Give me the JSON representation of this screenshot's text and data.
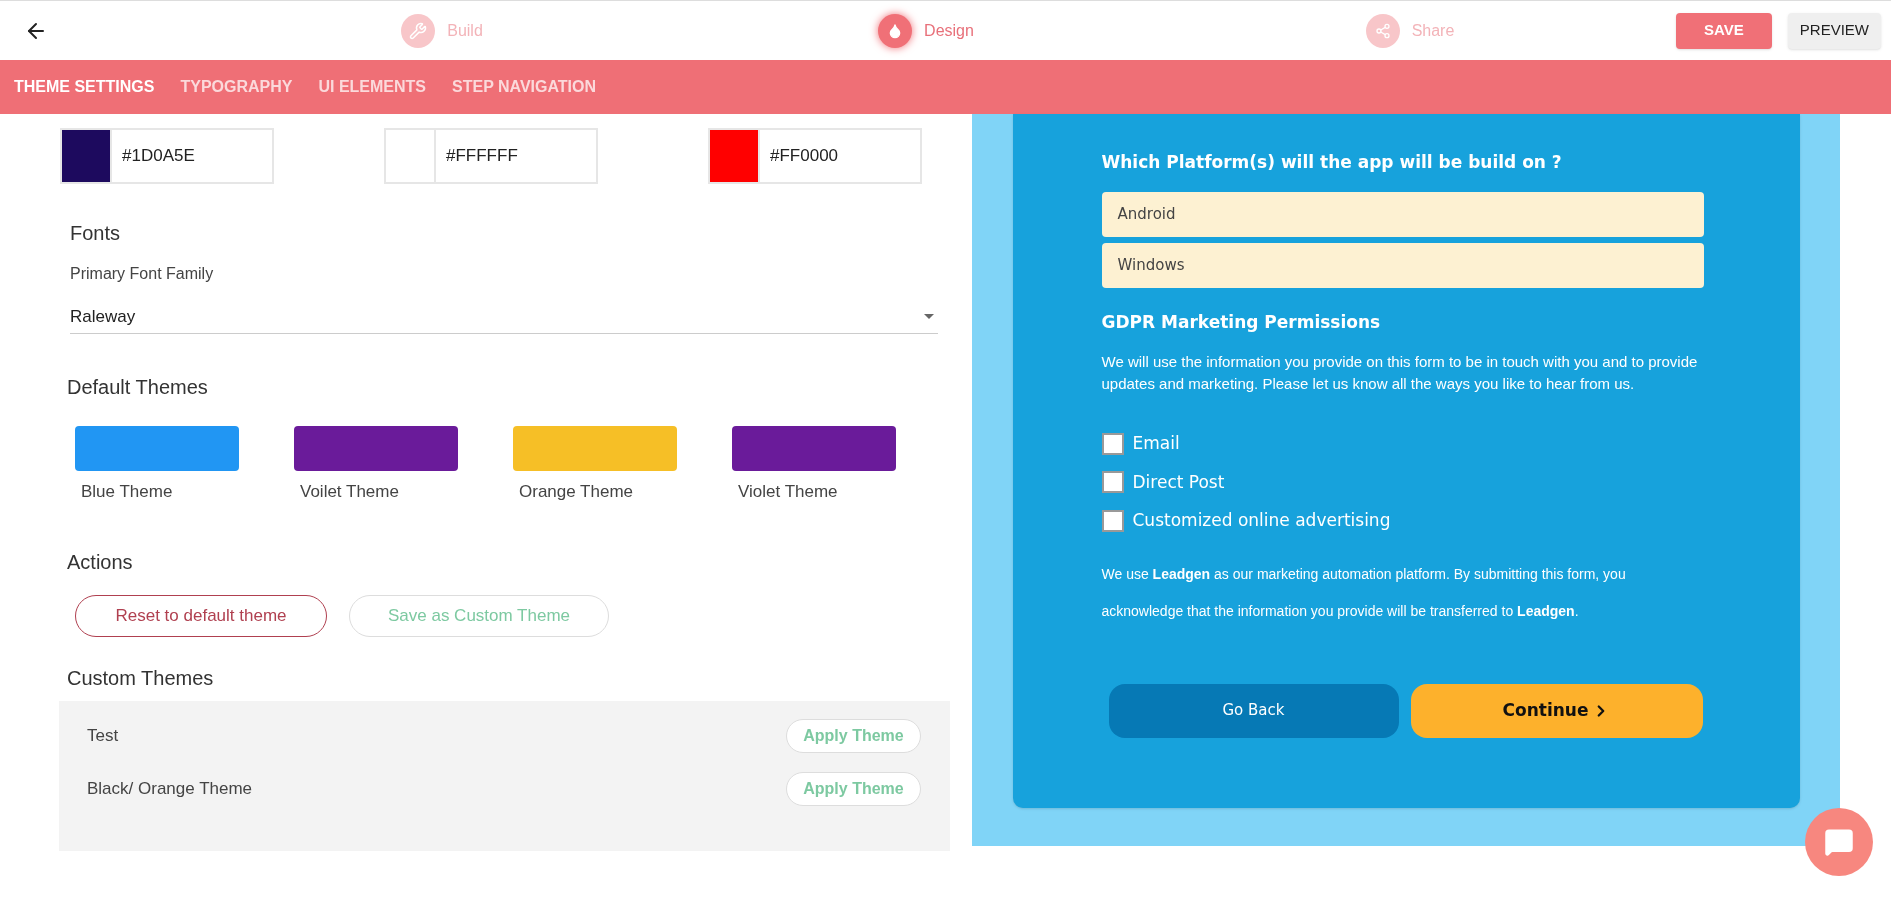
{
  "steps": [
    {
      "label": "Build",
      "kind": "build",
      "selected": false
    },
    {
      "label": "Design",
      "kind": "design",
      "selected": true
    },
    {
      "label": "Share",
      "kind": "share",
      "selected": false
    }
  ],
  "header_buttons": [
    {
      "label": "SAVE",
      "kind": "primary"
    },
    {
      "label": "PREVIEW",
      "kind": "secondary"
    }
  ],
  "tabs": [
    {
      "label": "THEME SETTINGS",
      "selected": true
    },
    {
      "label": "TYPOGRAPHY",
      "selected": false
    },
    {
      "label": "UI ELEMENTS",
      "selected": false
    },
    {
      "label": "STEP NAVIGATION",
      "selected": false
    }
  ],
  "colors": [
    {
      "value": "#1D0A5E",
      "color": "#1d0a5e"
    },
    {
      "value": "#FFFFFF",
      "color": "#ffffff"
    },
    {
      "value": "#FF0000",
      "color": "#ff0000"
    }
  ],
  "fonts": {
    "heading": "Fonts",
    "label": "Primary Font Family",
    "value": "Raleway"
  },
  "default_themes": {
    "heading": "Default Themes",
    "items": [
      {
        "name": "Blue Theme",
        "color": "#2196f3"
      },
      {
        "name": "Voilet Theme",
        "color": "#6a1b9a"
      },
      {
        "name": "Orange Theme",
        "color": "#f6bf26"
      },
      {
        "name": "Violet Theme",
        "color": "#6a1b9a"
      }
    ]
  },
  "actions": {
    "heading": "Actions",
    "buttons": [
      {
        "label": "Reset to default theme",
        "kind": "danger"
      },
      {
        "label": "Save as Custom Theme",
        "kind": "success"
      }
    ]
  },
  "custom_themes": {
    "heading": "Custom Themes",
    "items": [
      {
        "name": "Test",
        "button": "Apply Theme"
      },
      {
        "name": "Black/ Orange Theme",
        "button": "Apply Theme"
      }
    ]
  },
  "preview": {
    "question": "Which Platform(s) will the app will be build on ?",
    "options": [
      "Android",
      "Windows"
    ],
    "gdpr_heading": "GDPR Marketing Permissions",
    "gdpr_text": "We will use the information you provide on this form to be in touch with you and to provide updates and marketing. Please let us know all the ways you like to hear from us.",
    "checkboxes": [
      {
        "label": "Email",
        "checked": false
      },
      {
        "label": "Direct Post",
        "checked": false
      },
      {
        "label": "Customized online advertising",
        "checked": false
      }
    ],
    "legal_lines": [
      "We use **Leadgen** as our marketing automation platform. By submitting this form, you",
      "acknowledge that the information you provide will be transferred to **Leadgen**."
    ],
    "back_button": "Go Back",
    "continue_button": "Continue"
  }
}
